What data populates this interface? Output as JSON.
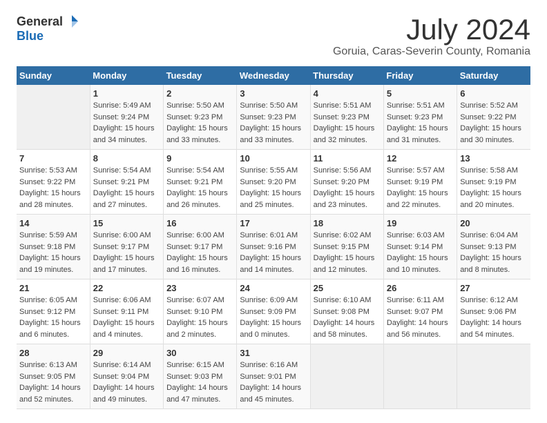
{
  "header": {
    "logo": {
      "general": "General",
      "blue": "Blue"
    },
    "title": "July 2024",
    "location": "Goruia, Caras-Severin County, Romania"
  },
  "days_of_week": [
    "Sunday",
    "Monday",
    "Tuesday",
    "Wednesday",
    "Thursday",
    "Friday",
    "Saturday"
  ],
  "weeks": [
    [
      {
        "day": "",
        "info": ""
      },
      {
        "day": "1",
        "info": "Sunrise: 5:49 AM\nSunset: 9:24 PM\nDaylight: 15 hours\nand 34 minutes."
      },
      {
        "day": "2",
        "info": "Sunrise: 5:50 AM\nSunset: 9:23 PM\nDaylight: 15 hours\nand 33 minutes."
      },
      {
        "day": "3",
        "info": "Sunrise: 5:50 AM\nSunset: 9:23 PM\nDaylight: 15 hours\nand 33 minutes."
      },
      {
        "day": "4",
        "info": "Sunrise: 5:51 AM\nSunset: 9:23 PM\nDaylight: 15 hours\nand 32 minutes."
      },
      {
        "day": "5",
        "info": "Sunrise: 5:51 AM\nSunset: 9:23 PM\nDaylight: 15 hours\nand 31 minutes."
      },
      {
        "day": "6",
        "info": "Sunrise: 5:52 AM\nSunset: 9:22 PM\nDaylight: 15 hours\nand 30 minutes."
      }
    ],
    [
      {
        "day": "7",
        "info": "Sunrise: 5:53 AM\nSunset: 9:22 PM\nDaylight: 15 hours\nand 28 minutes."
      },
      {
        "day": "8",
        "info": "Sunrise: 5:54 AM\nSunset: 9:21 PM\nDaylight: 15 hours\nand 27 minutes."
      },
      {
        "day": "9",
        "info": "Sunrise: 5:54 AM\nSunset: 9:21 PM\nDaylight: 15 hours\nand 26 minutes."
      },
      {
        "day": "10",
        "info": "Sunrise: 5:55 AM\nSunset: 9:20 PM\nDaylight: 15 hours\nand 25 minutes."
      },
      {
        "day": "11",
        "info": "Sunrise: 5:56 AM\nSunset: 9:20 PM\nDaylight: 15 hours\nand 23 minutes."
      },
      {
        "day": "12",
        "info": "Sunrise: 5:57 AM\nSunset: 9:19 PM\nDaylight: 15 hours\nand 22 minutes."
      },
      {
        "day": "13",
        "info": "Sunrise: 5:58 AM\nSunset: 9:19 PM\nDaylight: 15 hours\nand 20 minutes."
      }
    ],
    [
      {
        "day": "14",
        "info": "Sunrise: 5:59 AM\nSunset: 9:18 PM\nDaylight: 15 hours\nand 19 minutes."
      },
      {
        "day": "15",
        "info": "Sunrise: 6:00 AM\nSunset: 9:17 PM\nDaylight: 15 hours\nand 17 minutes."
      },
      {
        "day": "16",
        "info": "Sunrise: 6:00 AM\nSunset: 9:17 PM\nDaylight: 15 hours\nand 16 minutes."
      },
      {
        "day": "17",
        "info": "Sunrise: 6:01 AM\nSunset: 9:16 PM\nDaylight: 15 hours\nand 14 minutes."
      },
      {
        "day": "18",
        "info": "Sunrise: 6:02 AM\nSunset: 9:15 PM\nDaylight: 15 hours\nand 12 minutes."
      },
      {
        "day": "19",
        "info": "Sunrise: 6:03 AM\nSunset: 9:14 PM\nDaylight: 15 hours\nand 10 minutes."
      },
      {
        "day": "20",
        "info": "Sunrise: 6:04 AM\nSunset: 9:13 PM\nDaylight: 15 hours\nand 8 minutes."
      }
    ],
    [
      {
        "day": "21",
        "info": "Sunrise: 6:05 AM\nSunset: 9:12 PM\nDaylight: 15 hours\nand 6 minutes."
      },
      {
        "day": "22",
        "info": "Sunrise: 6:06 AM\nSunset: 9:11 PM\nDaylight: 15 hours\nand 4 minutes."
      },
      {
        "day": "23",
        "info": "Sunrise: 6:07 AM\nSunset: 9:10 PM\nDaylight: 15 hours\nand 2 minutes."
      },
      {
        "day": "24",
        "info": "Sunrise: 6:09 AM\nSunset: 9:09 PM\nDaylight: 15 hours\nand 0 minutes."
      },
      {
        "day": "25",
        "info": "Sunrise: 6:10 AM\nSunset: 9:08 PM\nDaylight: 14 hours\nand 58 minutes."
      },
      {
        "day": "26",
        "info": "Sunrise: 6:11 AM\nSunset: 9:07 PM\nDaylight: 14 hours\nand 56 minutes."
      },
      {
        "day": "27",
        "info": "Sunrise: 6:12 AM\nSunset: 9:06 PM\nDaylight: 14 hours\nand 54 minutes."
      }
    ],
    [
      {
        "day": "28",
        "info": "Sunrise: 6:13 AM\nSunset: 9:05 PM\nDaylight: 14 hours\nand 52 minutes."
      },
      {
        "day": "29",
        "info": "Sunrise: 6:14 AM\nSunset: 9:04 PM\nDaylight: 14 hours\nand 49 minutes."
      },
      {
        "day": "30",
        "info": "Sunrise: 6:15 AM\nSunset: 9:03 PM\nDaylight: 14 hours\nand 47 minutes."
      },
      {
        "day": "31",
        "info": "Sunrise: 6:16 AM\nSunset: 9:01 PM\nDaylight: 14 hours\nand 45 minutes."
      },
      {
        "day": "",
        "info": ""
      },
      {
        "day": "",
        "info": ""
      },
      {
        "day": "",
        "info": ""
      }
    ]
  ]
}
